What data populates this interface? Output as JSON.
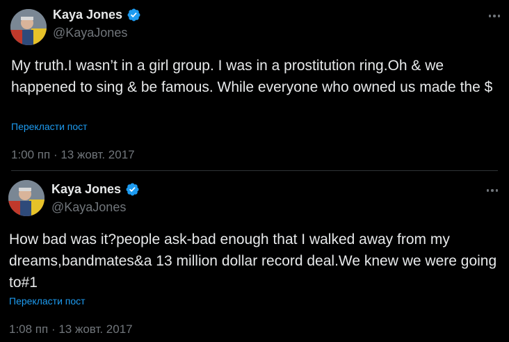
{
  "tweets": [
    {
      "author_name": "Kaya Jones",
      "handle": "@KayaJones",
      "text": "My truth.I wasn’t in a girl group. I was in a prostitution ring.Oh & we happened to sing & be famous. While everyone who owned us made the $",
      "translate_label": "Перекласти пост",
      "timestamp": "1:00 пп · 13 жовт. 2017"
    },
    {
      "author_name": "Kaya Jones",
      "handle": "@KayaJones",
      "text": "How bad was it?people ask-bad enough that I walked away from my dreams,bandmates&a 13 million dollar record deal.We knew we were going to#1",
      "translate_label": "Перекласти пост",
      "timestamp": "1:08 пп · 13 жовт. 2017"
    }
  ],
  "colors": {
    "background": "#000000",
    "text_primary": "#e7e9ea",
    "text_secondary": "#71767b",
    "link": "#1d9bf0",
    "verified_badge": "#1d9bf0",
    "divider": "#2f3336"
  },
  "icons": [
    "avatar",
    "verified-badge-icon",
    "more-options-icon"
  ]
}
